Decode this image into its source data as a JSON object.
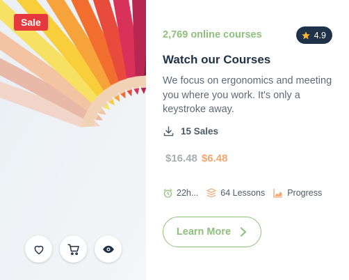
{
  "colors": {
    "accent_green": "#8ec07c",
    "sale_red": "#e5393d",
    "navy": "#1f3145",
    "price_old": "#a9adb1",
    "price_new": "#f4a56f",
    "star": "#f5b731"
  },
  "media": {
    "image_subject": "colored pencils arranged in a fan",
    "sale_label": "Sale",
    "actions": [
      {
        "name": "wishlist",
        "icon": "heart-icon"
      },
      {
        "name": "cart",
        "icon": "cart-icon"
      },
      {
        "name": "preview",
        "icon": "eye-icon"
      }
    ]
  },
  "course": {
    "online_count": "2,769 online courses",
    "rating": "4.9",
    "rating_icon": "star-icon",
    "title": "Watch our Courses",
    "description": "We focus on ergonomics and meeting you where you work. It's only a keystroke away.",
    "sales_icon": "download-icon",
    "sales": "15 Sales",
    "price_old": "$16.48",
    "price_new": "$6.48",
    "stats": {
      "duration_icon": "alarm-clock-icon",
      "duration": "22h...",
      "lessons_icon": "layers-icon",
      "lessons": "64 Lessons",
      "level_icon": "chart-icon",
      "level": "Progress"
    },
    "cta_label": "Learn More",
    "cta_icon": "chevron-right-icon"
  }
}
